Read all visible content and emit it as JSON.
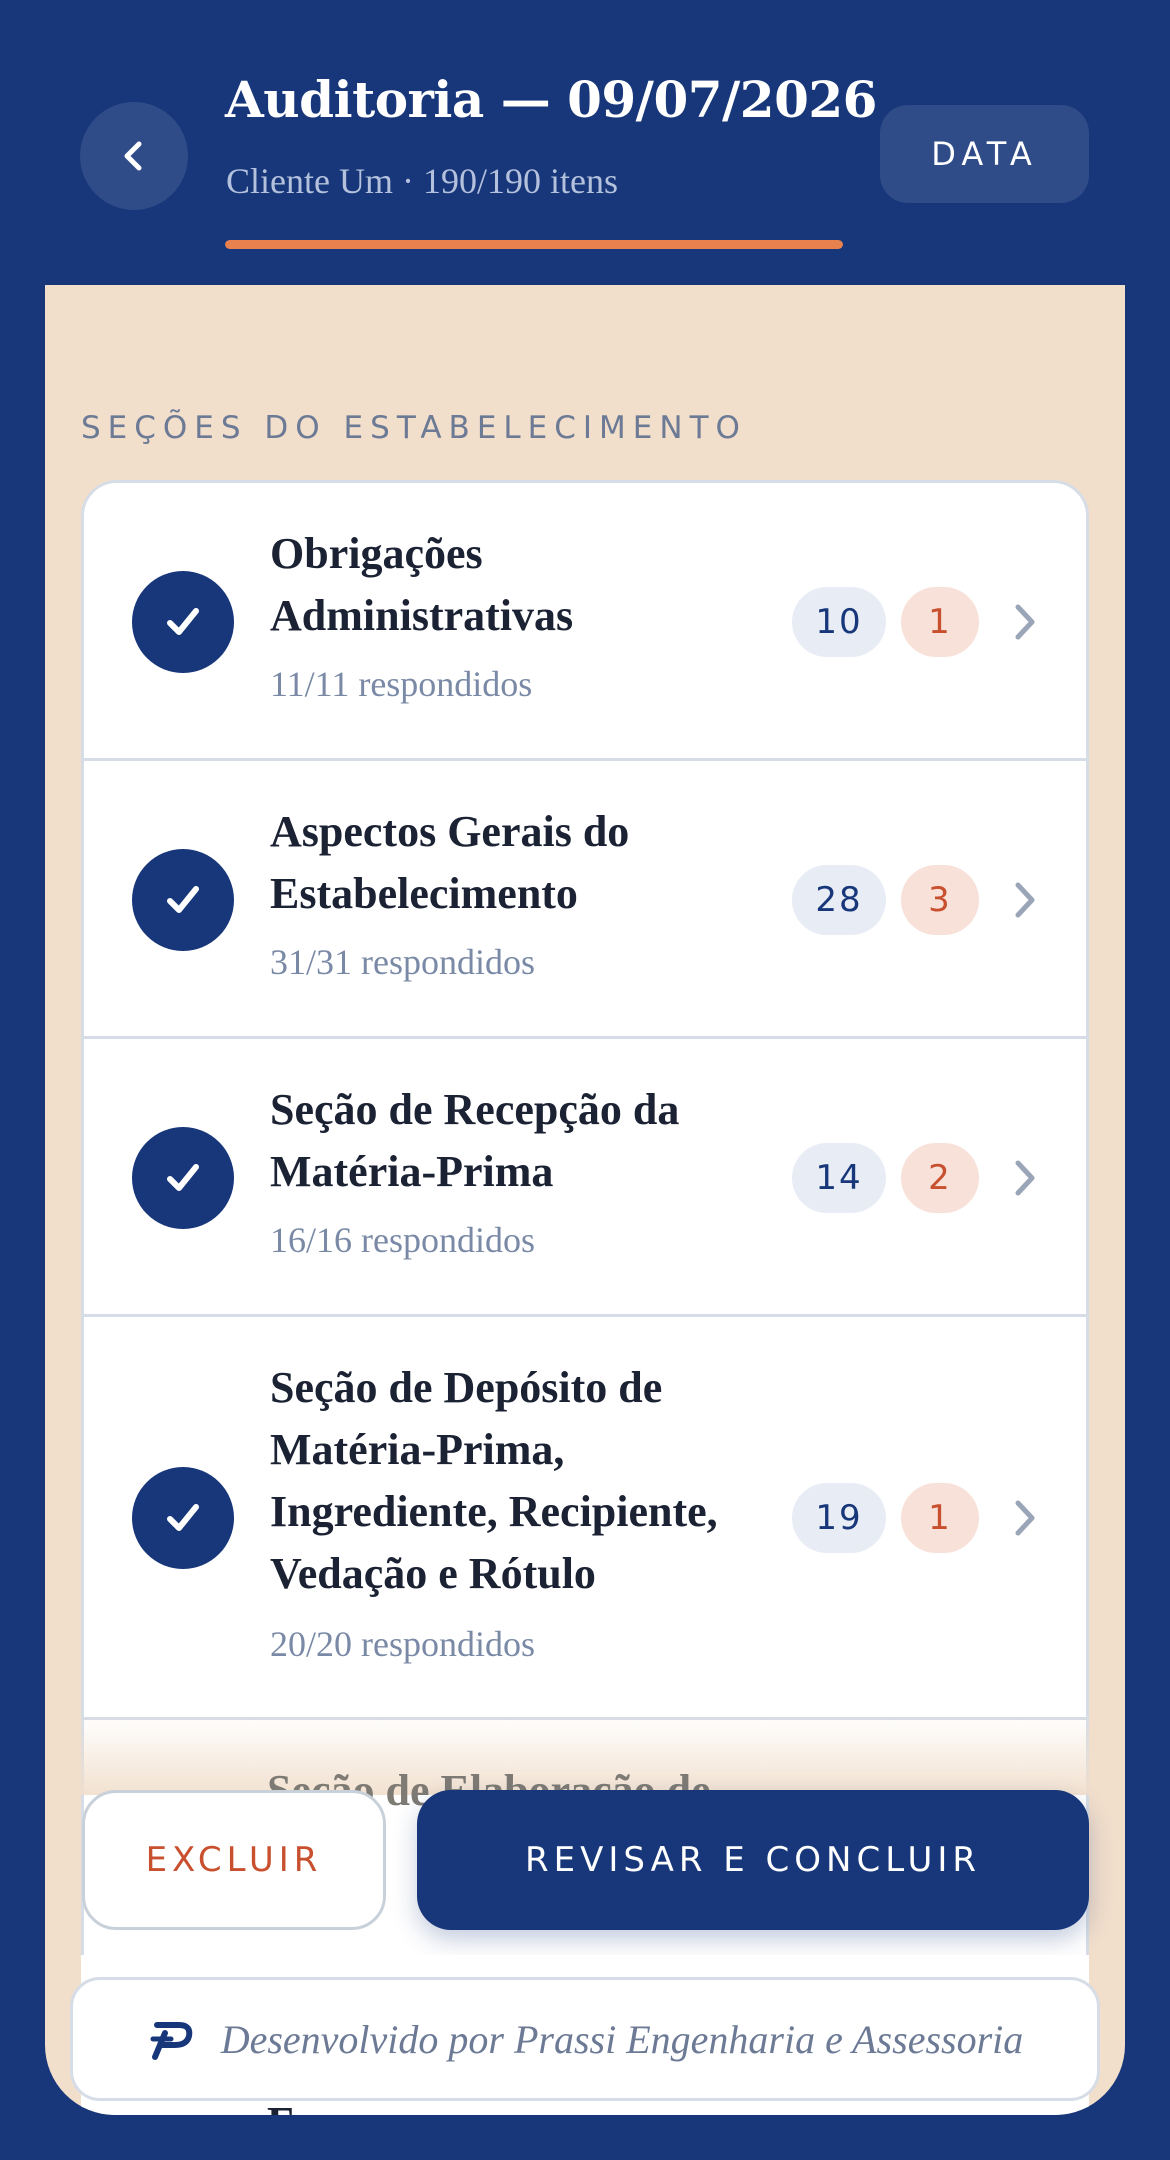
{
  "header": {
    "title": "Auditoria — 09/07/2026",
    "subtitle": "Cliente Um · 190/190 itens",
    "progress": 1.0,
    "data_button": "DATA"
  },
  "section_heading": "SEÇÕES DO ESTABELECIMENTO",
  "sections": [
    {
      "title": "Obrigações Administrativas",
      "answered": "11/11 respondidos",
      "ok_count": "10",
      "nc_count": "1"
    },
    {
      "title": "Aspectos Gerais do Estabelecimento",
      "answered": "31/31 respondidos",
      "ok_count": "28",
      "nc_count": "3"
    },
    {
      "title": "Seção de Recepção da Matéria-Prima",
      "answered": "16/16 respondidos",
      "ok_count": "14",
      "nc_count": "2"
    },
    {
      "title": "Seção de Depósito de Matéria-Prima, Ingrediente, Recipiente, Vedação e Rótulo",
      "answered": "20/20 respondidos",
      "ok_count": "19",
      "nc_count": "1"
    }
  ],
  "peek_next_section": "Seção de Elaboração de",
  "peek_footer_text": "F",
  "actions": {
    "delete_label": "EXCLUIR",
    "review_label": "REVISAR E CONCLUIR"
  },
  "credit": {
    "text": "Desenvolvido por Prassi Engenharia e Assessoria",
    "logo_icon": "prassi-logo-icon"
  },
  "colors": {
    "primary": "#17377a",
    "accent": "#e9814f",
    "background_panel": "#f1decb",
    "danger": "#c8502f"
  }
}
